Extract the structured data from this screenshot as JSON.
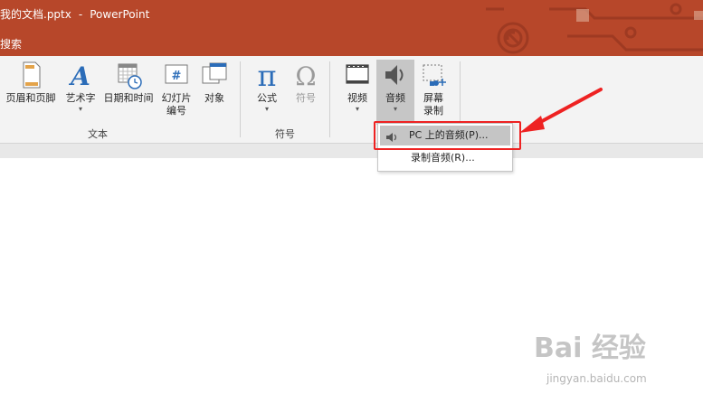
{
  "window": {
    "doc_title": "我的文档.pptx",
    "separator": "-",
    "app_name": "PowerPoint"
  },
  "tell_me": {
    "label": "搜索"
  },
  "ribbon": {
    "groups": [
      {
        "label": "文本"
      },
      {
        "label": "符号"
      }
    ],
    "buttons": {
      "header_footer": "页眉和页脚",
      "wordart": "艺术字",
      "date_time": "日期和时间",
      "slide_number_line1": "幻灯片",
      "slide_number_line2": "编号",
      "object": "对象",
      "equation": "公式",
      "symbol": "符号",
      "video": "视频",
      "audio": "音频",
      "screen_rec_line1": "屏幕",
      "screen_rec_line2": "录制"
    },
    "glyphs": {
      "pi": "π",
      "omega": "Ω",
      "wordart_a": "A",
      "hash": "#",
      "chevron": "▾"
    }
  },
  "audio_menu": {
    "items": [
      {
        "label": "PC 上的音频(P)..."
      },
      {
        "label": "录制音频(R)..."
      }
    ]
  },
  "watermark": {
    "main": "Bai 经验",
    "sub": "jingyan.baidu.com"
  },
  "colors": {
    "title_bar": "#b7472a",
    "ribbon_bg": "#f3f3f3",
    "highlight": "#ee2222",
    "audio_selected": "#c6c6c6"
  }
}
